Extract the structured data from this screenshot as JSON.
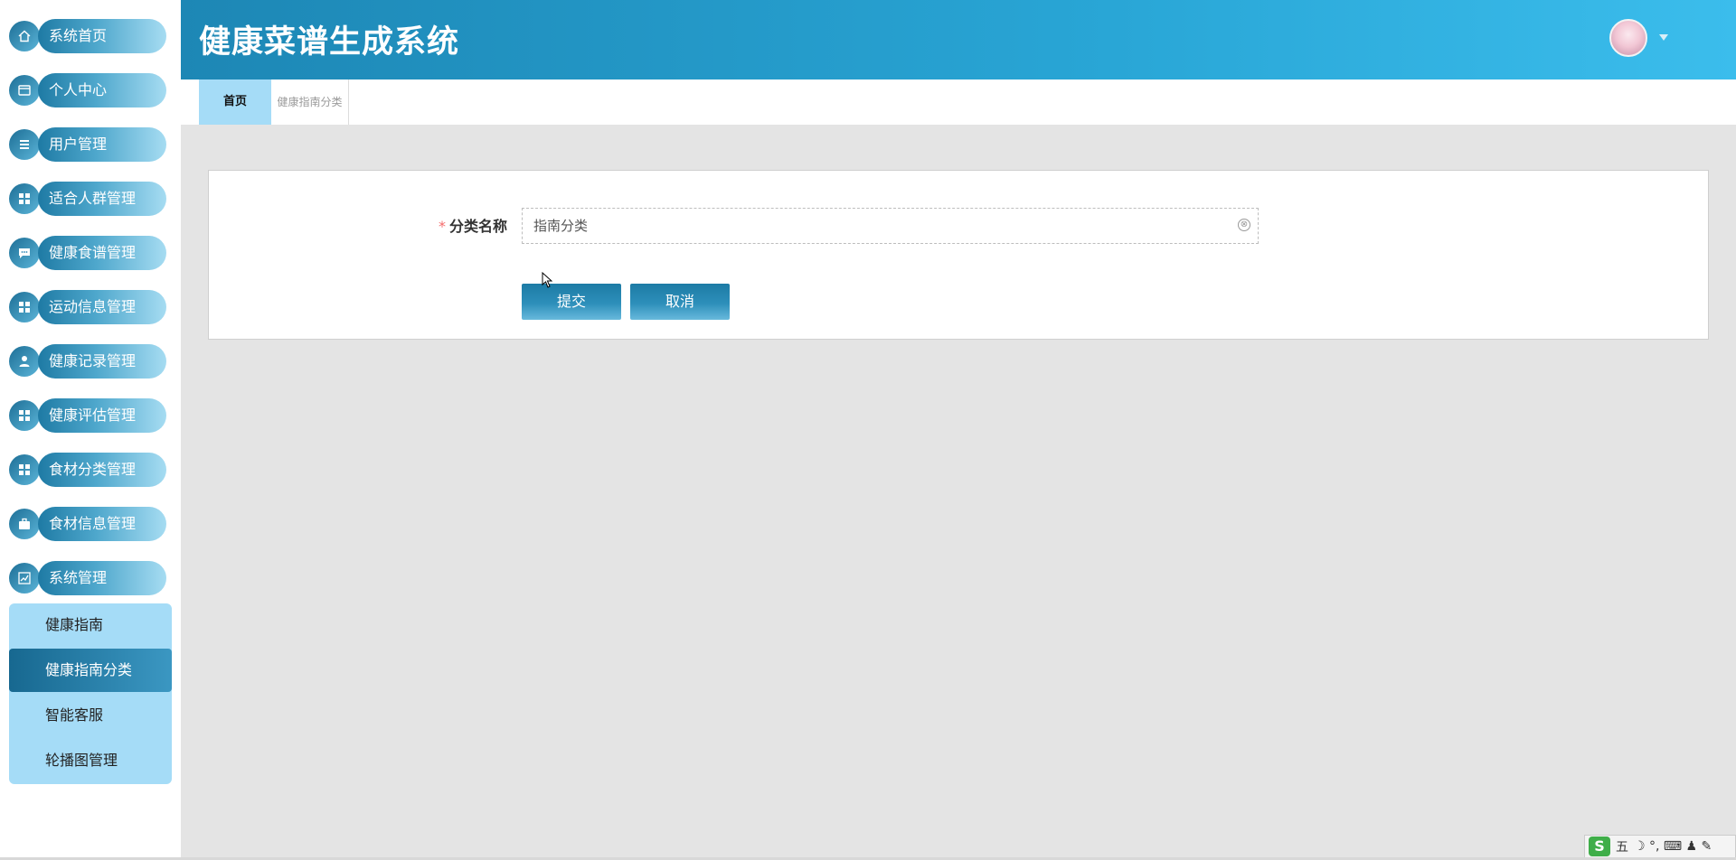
{
  "header": {
    "title": "健康菜谱生成系统"
  },
  "sidebar": {
    "items": [
      {
        "label": "系统首页",
        "icon": "home-icon"
      },
      {
        "label": "个人中心",
        "icon": "wallet-icon"
      },
      {
        "label": "用户管理",
        "icon": "list-icon"
      },
      {
        "label": "适合人群管理",
        "icon": "grid-icon"
      },
      {
        "label": "健康食谱管理",
        "icon": "chat-icon"
      },
      {
        "label": "运动信息管理",
        "icon": "grid-icon"
      },
      {
        "label": "健康记录管理",
        "icon": "user-icon"
      },
      {
        "label": "健康评估管理",
        "icon": "grid-icon"
      },
      {
        "label": "食材分类管理",
        "icon": "grid-icon"
      },
      {
        "label": "食材信息管理",
        "icon": "briefcase-icon"
      },
      {
        "label": "系统管理",
        "icon": "chart-icon"
      }
    ],
    "submenu": [
      {
        "label": "健康指南",
        "active": false
      },
      {
        "label": "健康指南分类",
        "active": true
      },
      {
        "label": "智能客服",
        "active": false
      },
      {
        "label": "轮播图管理",
        "active": false
      }
    ]
  },
  "tabs": [
    {
      "label": "首页"
    },
    {
      "label": "健康指南分类"
    }
  ],
  "form": {
    "required_mark": "*",
    "field_label": "分类名称",
    "field_value": "指南分类",
    "clear_icon": "⊗",
    "submit_label": "提交",
    "cancel_label": "取消"
  },
  "ime": {
    "logo": "S",
    "mode": "五",
    "symbols": "☽ °, ⌨ ♟ ✎"
  },
  "colors": {
    "accent": "#1d87b5",
    "submenu_bg": "#a5dcf7",
    "required": "#f56c6c"
  }
}
